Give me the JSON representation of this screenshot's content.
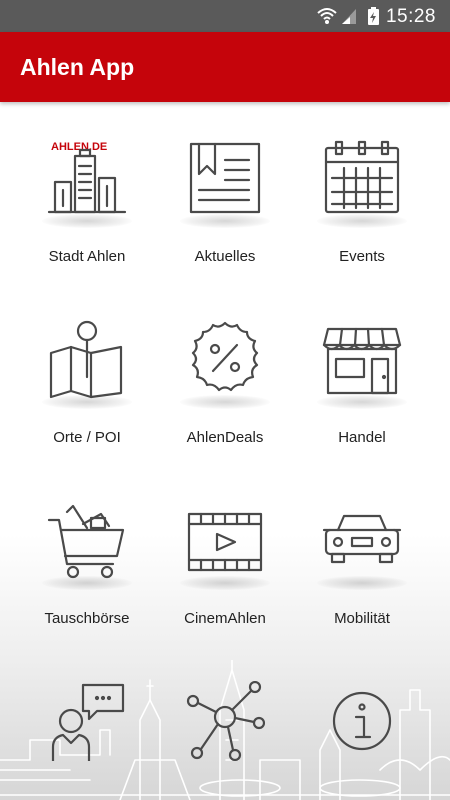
{
  "status_bar": {
    "time": "15:28",
    "icons": [
      "wifi-icon",
      "signal-icon",
      "battery-charging-icon"
    ]
  },
  "app_bar": {
    "title": "Ahlen App",
    "color": "#c5040b"
  },
  "menu": {
    "items": [
      {
        "label": "Stadt Ahlen",
        "icon": "city-buildings-icon",
        "logo_text": "AHLEN.DE"
      },
      {
        "label": "Aktuelles",
        "icon": "newspaper-icon"
      },
      {
        "label": "Events",
        "icon": "calendar-icon"
      },
      {
        "label": "Orte / POI",
        "icon": "map-pin-icon"
      },
      {
        "label": "AhlenDeals",
        "icon": "percent-badge-icon"
      },
      {
        "label": "Handel",
        "icon": "storefront-icon"
      },
      {
        "label": "Tauschbörse",
        "icon": "shopping-cart-icon"
      },
      {
        "label": "CinemAhlen",
        "icon": "video-film-icon"
      },
      {
        "label": "Mobilität",
        "icon": "car-icon"
      },
      {
        "label": "",
        "icon": "person-chat-icon"
      },
      {
        "label": "",
        "icon": "network-icon"
      },
      {
        "label": "",
        "icon": "info-icon"
      }
    ]
  }
}
